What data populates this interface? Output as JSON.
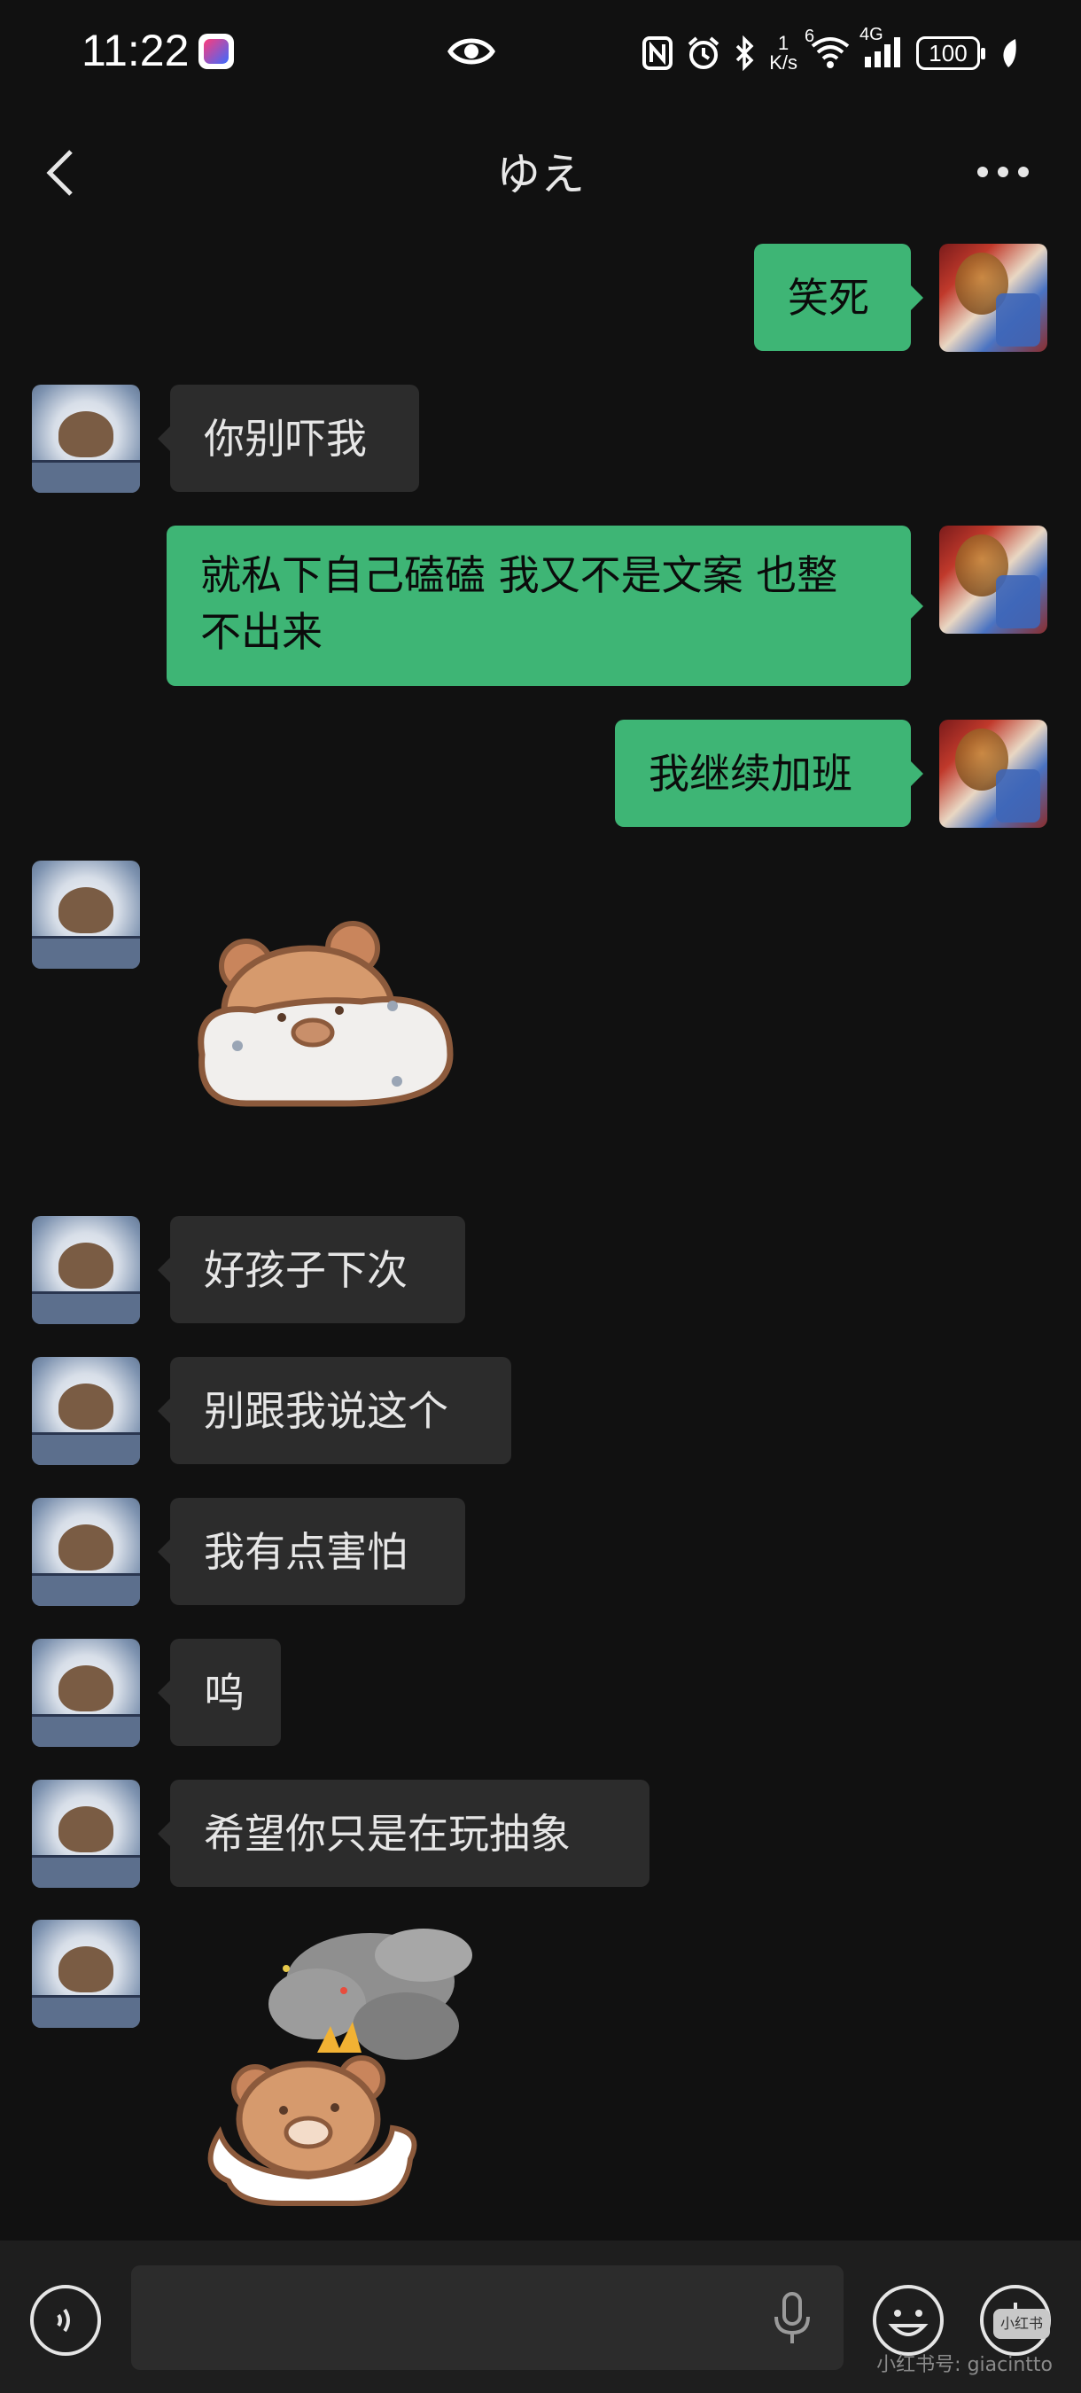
{
  "status_bar": {
    "time": "11:22",
    "speed_value": "1",
    "speed_unit": "K/s",
    "wifi_label": "6",
    "network": "4G",
    "battery": "100",
    "icons": [
      "app-notification-icon",
      "eye-icon",
      "nfc-icon",
      "alarm-icon",
      "bluetooth-icon",
      "wifi-icon",
      "signal-icon",
      "battery-icon",
      "leaf-icon"
    ]
  },
  "header": {
    "title": "ゆえ",
    "back_icon": "back-icon",
    "more_icon": "more-icon"
  },
  "messages": [
    {
      "side": "right",
      "type": "text",
      "text": "笑死"
    },
    {
      "side": "left",
      "type": "text",
      "text": "你别吓我"
    },
    {
      "side": "right",
      "type": "text",
      "text": "就私下自己磕磕 我又不是文案 也整不出来"
    },
    {
      "side": "right",
      "type": "text",
      "text": "我继续加班"
    },
    {
      "side": "left",
      "type": "sticker",
      "sticker": "bear-lying-sticker"
    },
    {
      "side": "left",
      "type": "text",
      "text": "好孩子下次"
    },
    {
      "side": "left",
      "type": "text",
      "text": "别跟我说这个"
    },
    {
      "side": "left",
      "type": "text",
      "text": "我有点害怕"
    },
    {
      "side": "left",
      "type": "text",
      "text": "呜"
    },
    {
      "side": "left",
      "type": "text",
      "text": "希望你只是在玩抽象"
    },
    {
      "side": "left",
      "type": "sticker",
      "sticker": "bear-smoke-sticker"
    }
  ],
  "input_bar": {
    "text_value": "",
    "icons": [
      "voice-icon",
      "mic-icon",
      "emoji-icon",
      "plus-icon"
    ]
  },
  "watermark": {
    "badge": "小红书",
    "text": "小红书号: giacintto"
  },
  "colors": {
    "background": "#111111",
    "sent_bubble": "#3eb575",
    "received_bubble": "#2c2c2c"
  }
}
